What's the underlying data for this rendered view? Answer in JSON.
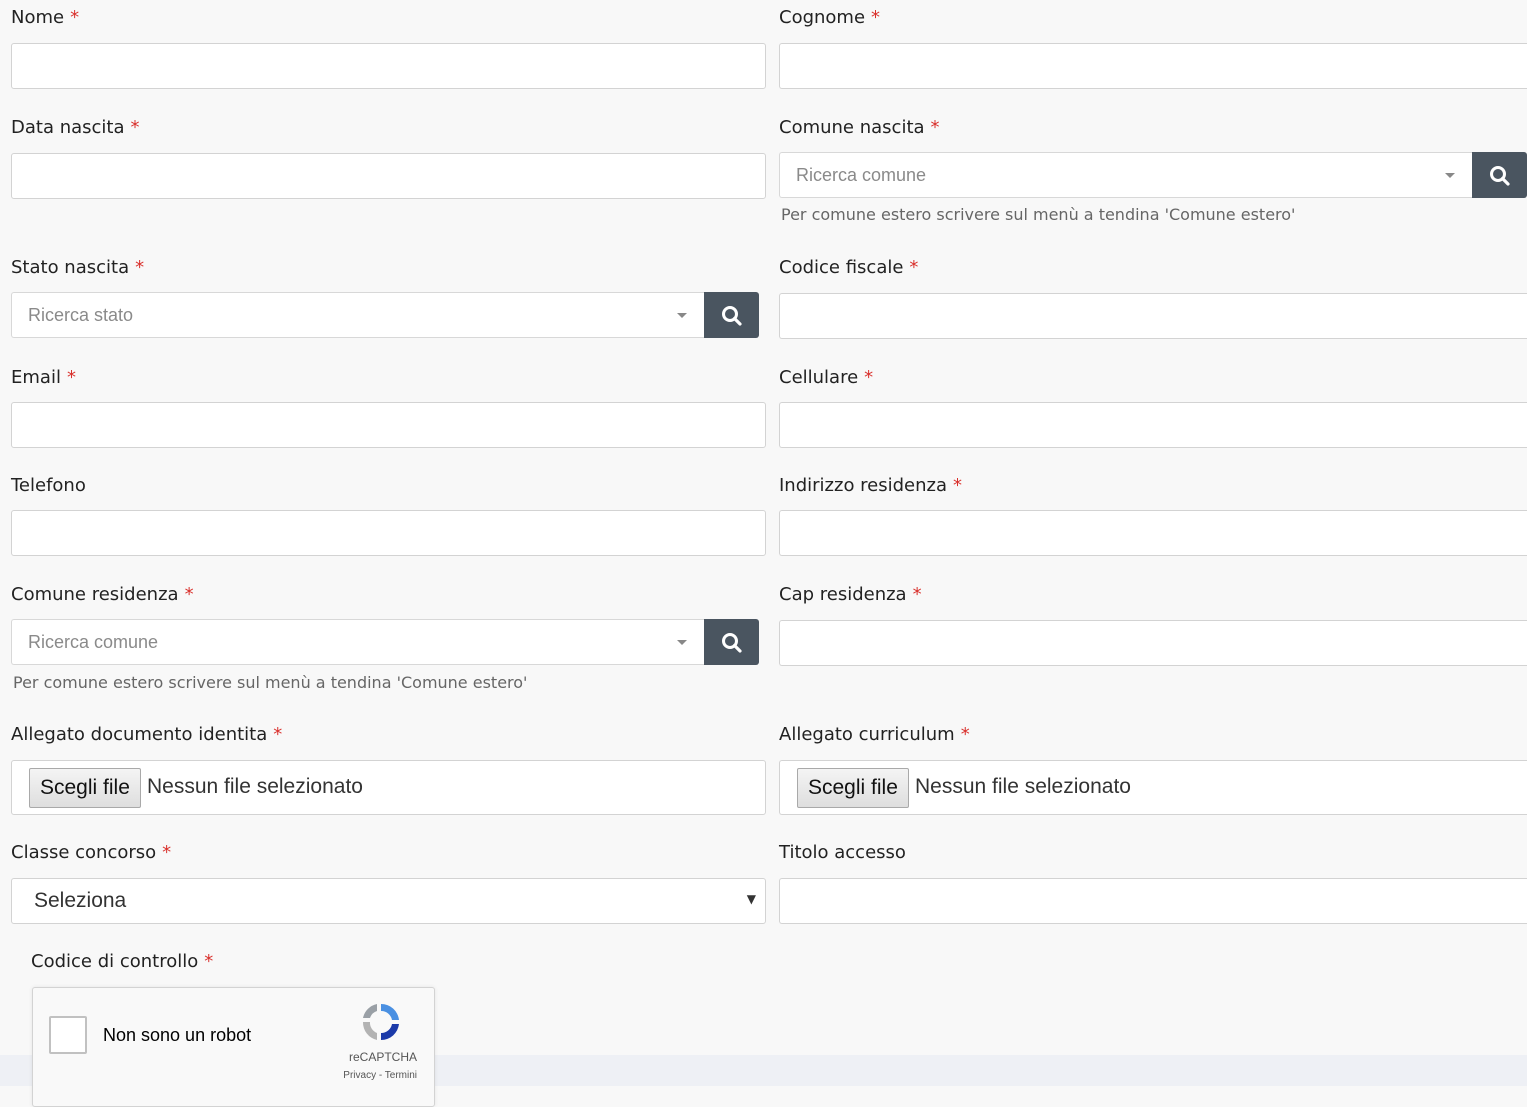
{
  "form": {
    "nome": {
      "label": "Nome",
      "required": "*"
    },
    "cognome": {
      "label": "Cognome",
      "required": "*"
    },
    "data_nascita": {
      "label": "Data nascita",
      "required": "*"
    },
    "comune_nascita": {
      "label": "Comune nascita",
      "required": "*",
      "placeholder": "Ricerca comune",
      "help": "Per comune estero scrivere sul menù a tendina 'Comune estero'"
    },
    "stato_nascita": {
      "label": "Stato nascita",
      "required": "*",
      "placeholder": "Ricerca stato"
    },
    "codice_fiscale": {
      "label": "Codice fiscale",
      "required": "*"
    },
    "email": {
      "label": "Email",
      "required": "*"
    },
    "cellulare": {
      "label": "Cellulare",
      "required": "*"
    },
    "telefono": {
      "label": "Telefono"
    },
    "indirizzo_residenza": {
      "label": "Indirizzo residenza",
      "required": "*"
    },
    "comune_residenza": {
      "label": "Comune residenza",
      "required": "*",
      "placeholder": "Ricerca comune",
      "help": "Per comune estero scrivere sul menù a tendina 'Comune estero'"
    },
    "cap_residenza": {
      "label": "Cap residenza",
      "required": "*"
    },
    "allegato_documento": {
      "label": "Allegato documento identita",
      "required": "*",
      "button": "Scegli file",
      "status": "Nessun file selezionato"
    },
    "allegato_curriculum": {
      "label": "Allegato curriculum",
      "required": "*",
      "button": "Scegli file",
      "status": "Nessun file selezionato"
    },
    "classe_concorso": {
      "label": "Classe concorso",
      "required": "*",
      "selected": "Seleziona"
    },
    "titolo_accesso": {
      "label": "Titolo accesso"
    },
    "codice_controllo": {
      "label": "Codice di controllo",
      "required": "*"
    }
  },
  "captcha": {
    "checkbox_label": "Non sono un robot",
    "brand": "reCAPTCHA",
    "links": "Privacy - Termini"
  },
  "icons": {
    "search": "search-icon",
    "dropdown": "caret-down-icon",
    "recaptcha": "recaptcha-logo-icon"
  },
  "colors": {
    "required": "#d9302c",
    "search_button": "#4a5560",
    "page_bg": "#f8f8f8"
  }
}
